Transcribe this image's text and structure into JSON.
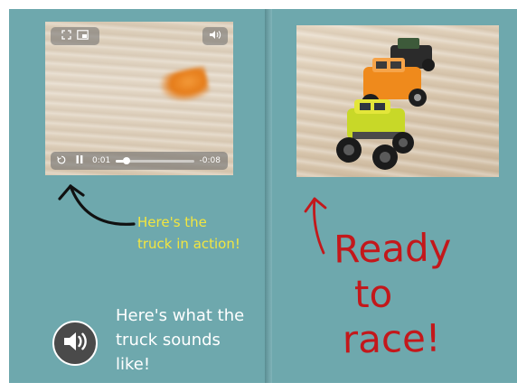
{
  "video": {
    "current_time": "0:01",
    "remaining_time": "-0:08",
    "progress": 0.14
  },
  "captions": {
    "action_line1": "Here's the",
    "action_line2": "truck in action!",
    "sound_line1": "Here's what the",
    "sound_line2": "truck sounds",
    "sound_line3": "like!",
    "race_line1": "Ready",
    "race_line2": "to",
    "race_line3": "race!"
  },
  "colors": {
    "page": "#6ea8ad",
    "action_caption": "#f2e640",
    "race_text": "#c3181b"
  },
  "icons": {
    "fullscreen": "expand-icon",
    "pip": "picture-in-picture-icon",
    "volume": "volume-icon",
    "replay": "replay-icon",
    "pause": "pause-icon",
    "audio": "speaker-icon"
  }
}
